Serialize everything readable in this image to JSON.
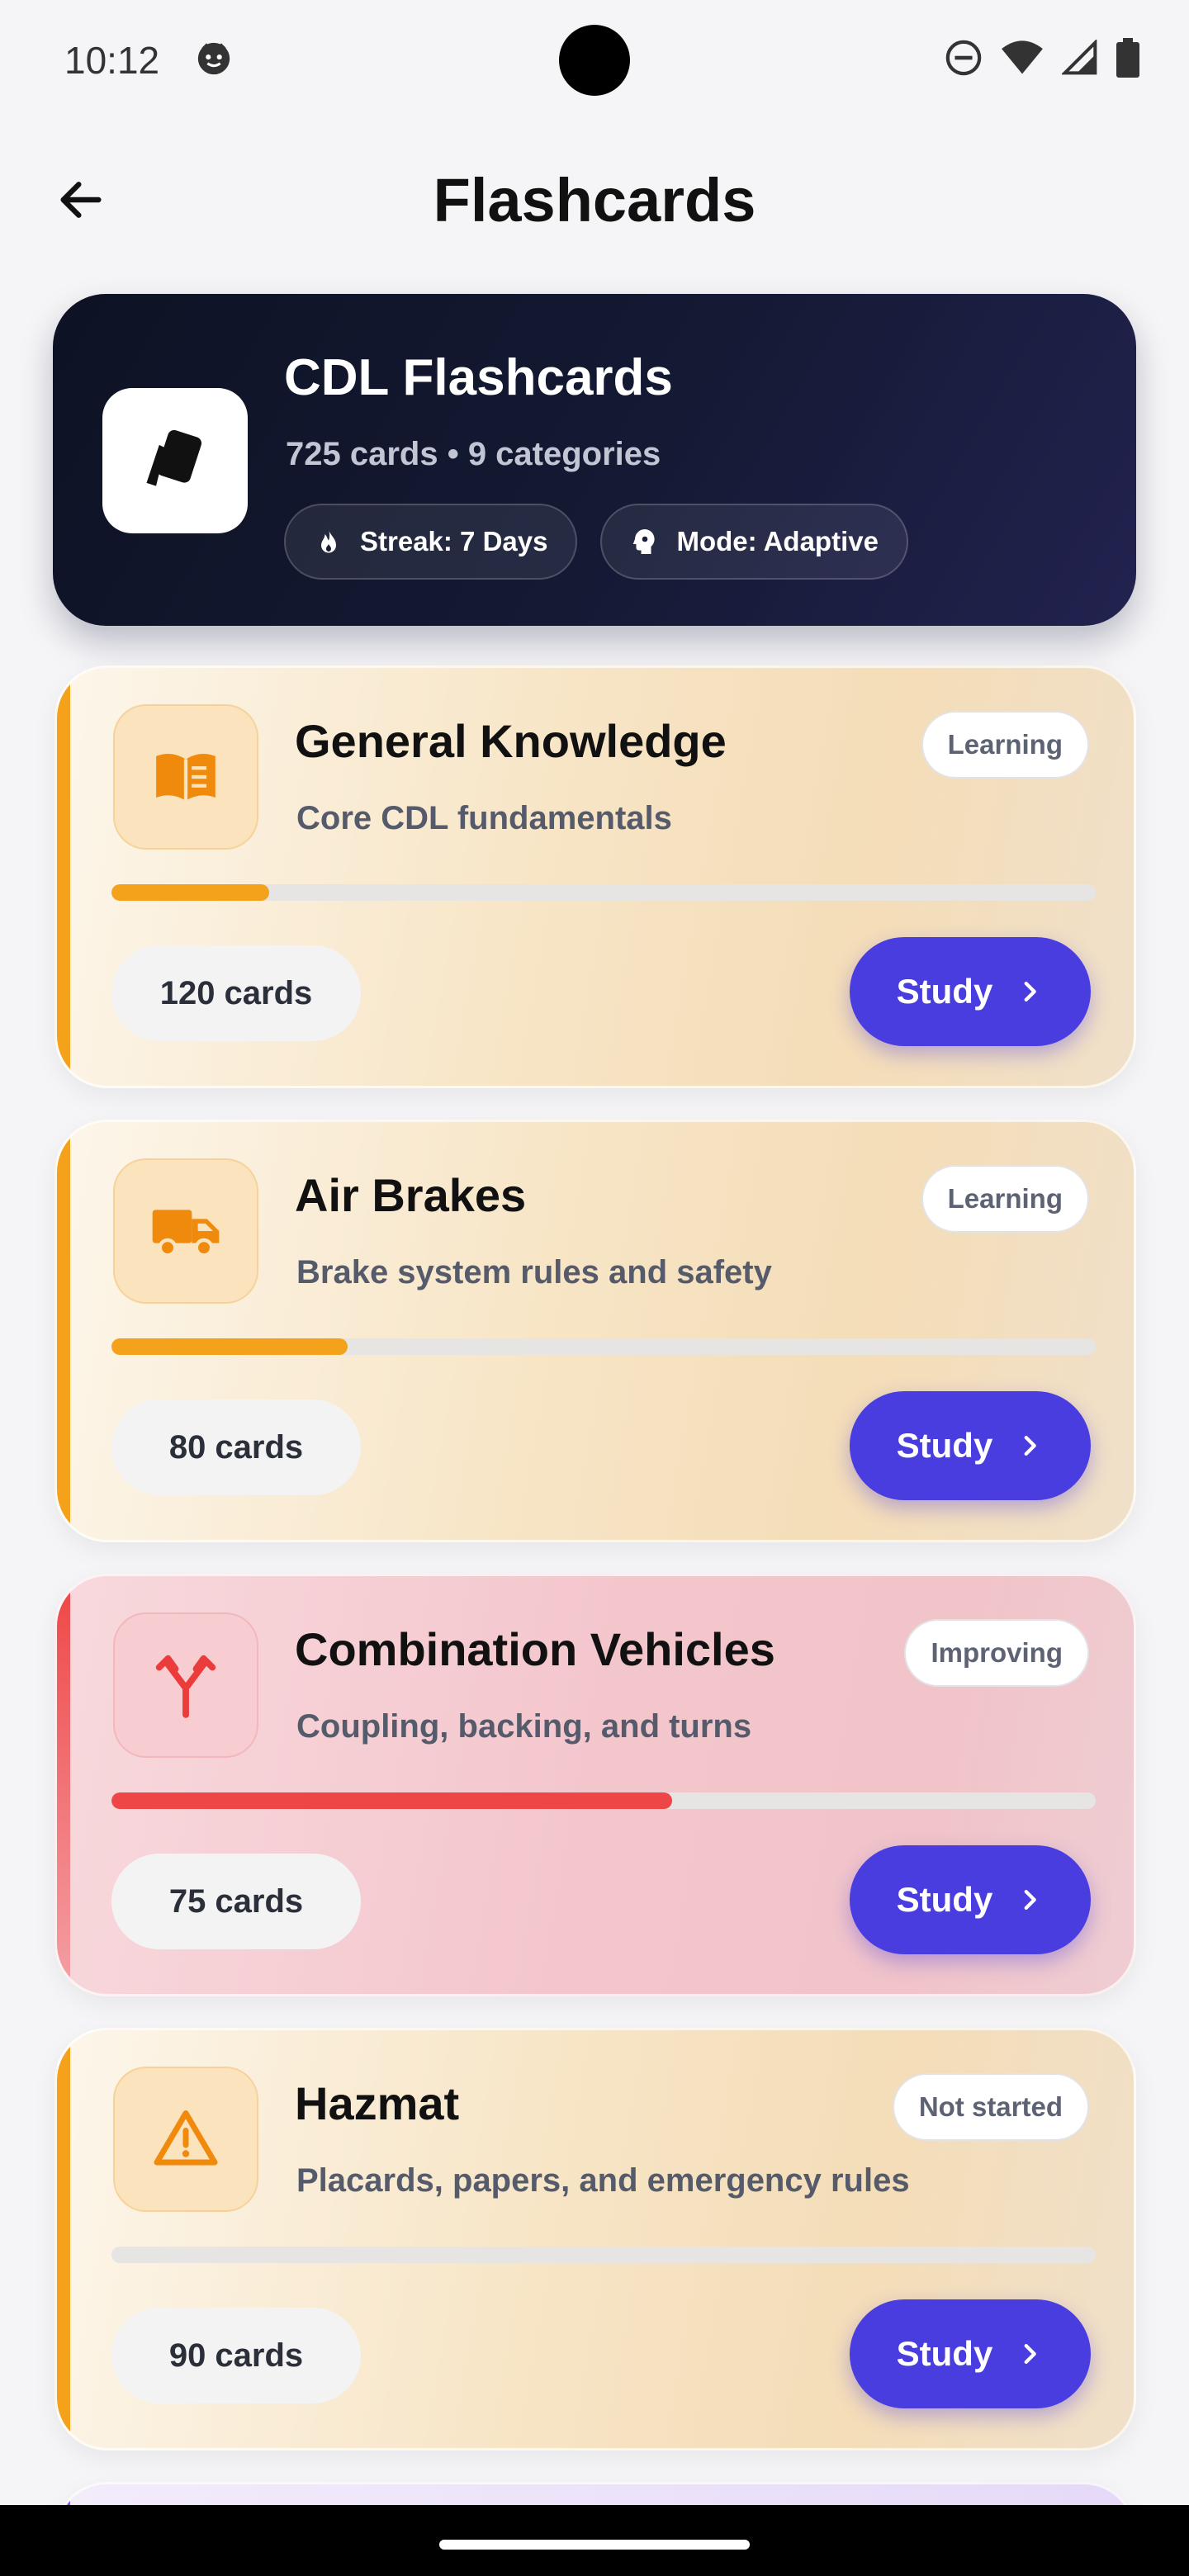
{
  "status_bar": {
    "time": "10:12"
  },
  "app_bar": {
    "title": "Flashcards"
  },
  "hero": {
    "title": "CDL Flashcards",
    "subtitle": "725 cards • 9 categories",
    "chips": [
      {
        "icon": "flame-icon",
        "label": "Streak: 7 Days"
      },
      {
        "icon": "brain-icon",
        "label": "Mode: Adaptive"
      }
    ]
  },
  "categories": [
    {
      "title": "General Knowledge",
      "subtitle": "Core CDL fundamentals",
      "status": "Learning",
      "progress": 0.16,
      "cards": "120 cards",
      "study_label": "Study",
      "icon": "book-icon",
      "accent": "#f4a21c"
    },
    {
      "title": "Air Brakes",
      "subtitle": "Brake system rules and safety",
      "status": "Learning",
      "progress": 0.24,
      "cards": "80 cards",
      "study_label": "Study",
      "icon": "truck-icon",
      "accent": "#f4a21c"
    },
    {
      "title": "Combination Vehicles",
      "subtitle": "Coupling, backing, and turns",
      "status": "Improving",
      "progress": 0.57,
      "cards": "75 cards",
      "study_label": "Study",
      "icon": "merge-arrows-icon",
      "accent": "#ee4646"
    },
    {
      "title": "Hazmat",
      "subtitle": "Placards, papers, and emergency rules",
      "status": "Not started",
      "progress": 0,
      "cards": "90 cards",
      "study_label": "Study",
      "icon": "warning-icon",
      "accent": "#f4a21c"
    }
  ],
  "colors": {
    "primary": "#4a3de0",
    "amber": "#f4a21c",
    "red": "#ee4646",
    "hero_bg": "#0e1224"
  }
}
